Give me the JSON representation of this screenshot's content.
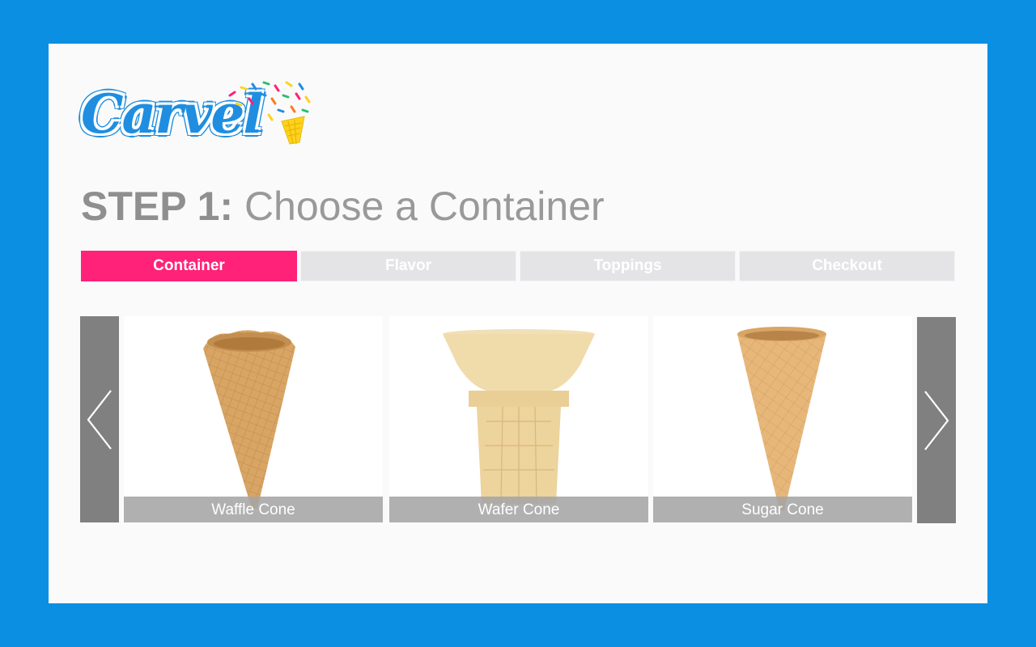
{
  "brand": {
    "name": "Carvel",
    "colors": {
      "frame": "#0a8fe3",
      "accent": "#ff2278",
      "logo": "#1f8ee0"
    }
  },
  "heading": {
    "step": "STEP 1:",
    "title": "Choose a Container"
  },
  "progress": {
    "steps": [
      {
        "label": "Container",
        "active": true
      },
      {
        "label": "Flavor",
        "active": false
      },
      {
        "label": "Toppings",
        "active": false
      },
      {
        "label": "Checkout",
        "active": false
      }
    ]
  },
  "carousel": {
    "prev_icon": "chevron-left-icon",
    "next_icon": "chevron-right-icon",
    "items": [
      {
        "label": "Waffle Cone"
      },
      {
        "label": "Wafer Cone"
      },
      {
        "label": "Sugar Cone"
      }
    ]
  }
}
